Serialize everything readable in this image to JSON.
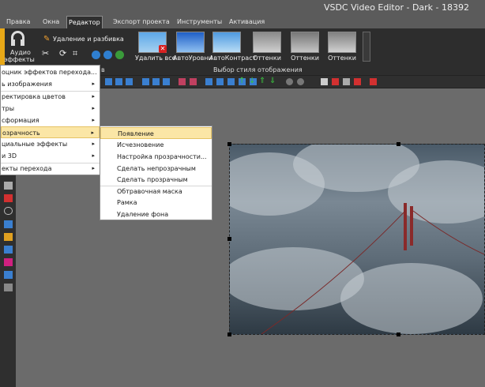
{
  "window": {
    "title": "VSDC Video Editor - Dark - 18392"
  },
  "tabs": [
    "Правка",
    "Окна",
    "Редактор",
    "Экспорт проекта",
    "Инструменты",
    "Активация"
  ],
  "ribbon": {
    "audio_line1": "Аудио",
    "audio_line2": "эффекты",
    "split_label": "Удаление и разбивка",
    "presets": [
      "Удалить все",
      "АвтоУровни",
      "АвтоКонтраст",
      "Оттенки",
      "Оттенки",
      "Оттенки"
    ],
    "group_left_tail": "в",
    "group_styles": "Выбор стиля отображения"
  },
  "menu": {
    "items": [
      {
        "label": "оцник эффектов перехода...",
        "arrow": ""
      },
      {
        "label": "ь изображения",
        "arrow": "▸"
      },
      {
        "label": "ректировка цветов",
        "arrow": "▸"
      },
      {
        "label": "тры",
        "arrow": "▸"
      },
      {
        "label": "сформация",
        "arrow": "▸"
      },
      {
        "label": "озрачность",
        "arrow": "▸"
      },
      {
        "label": "циальные эффекты",
        "arrow": "▸"
      },
      {
        "label": "и 3D",
        "arrow": "▸"
      },
      {
        "label": "екты перехода",
        "arrow": "▸"
      }
    ]
  },
  "submenu": {
    "items": [
      "Появление",
      "Исчезновение",
      "Настройка прозрачности...",
      "Сделать непрозрачным",
      "Сделать прозрачным",
      "Обтравочная маска",
      "Рамка",
      "Удаление фона"
    ]
  },
  "colors": {
    "accent": "#e8a817",
    "highlight": "#fbe6a6",
    "panel": "#2d2d2d",
    "workspace": "#6b6b6b"
  }
}
